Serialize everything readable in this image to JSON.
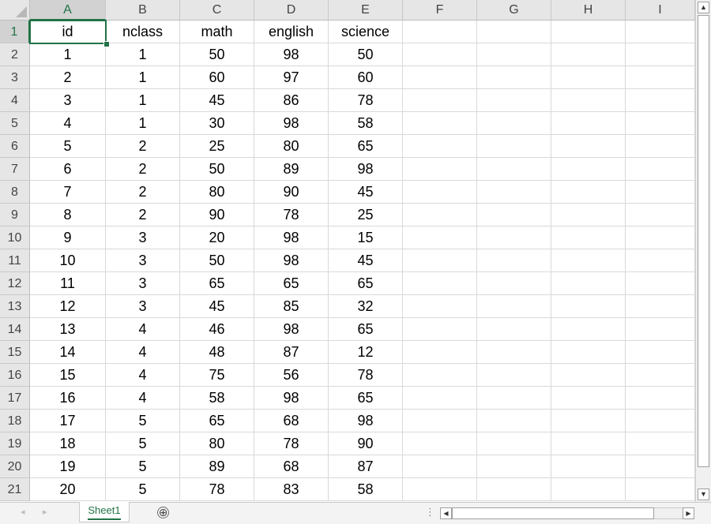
{
  "columns": [
    "A",
    "B",
    "C",
    "D",
    "E",
    "F",
    "G",
    "H",
    "I"
  ],
  "active_cell": "A1",
  "sheet": {
    "header": [
      "id",
      "nclass",
      "math",
      "english",
      "science"
    ],
    "rows": [
      [
        "1",
        "1",
        "50",
        "98",
        "50"
      ],
      [
        "2",
        "1",
        "60",
        "97",
        "60"
      ],
      [
        "3",
        "1",
        "45",
        "86",
        "78"
      ],
      [
        "4",
        "1",
        "30",
        "98",
        "58"
      ],
      [
        "5",
        "2",
        "25",
        "80",
        "65"
      ],
      [
        "6",
        "2",
        "50",
        "89",
        "98"
      ],
      [
        "7",
        "2",
        "80",
        "90",
        "45"
      ],
      [
        "8",
        "2",
        "90",
        "78",
        "25"
      ],
      [
        "9",
        "3",
        "20",
        "98",
        "15"
      ],
      [
        "10",
        "3",
        "50",
        "98",
        "45"
      ],
      [
        "11",
        "3",
        "65",
        "65",
        "65"
      ],
      [
        "12",
        "3",
        "45",
        "85",
        "32"
      ],
      [
        "13",
        "4",
        "46",
        "98",
        "65"
      ],
      [
        "14",
        "4",
        "48",
        "87",
        "12"
      ],
      [
        "15",
        "4",
        "75",
        "56",
        "78"
      ],
      [
        "16",
        "4",
        "58",
        "98",
        "65"
      ],
      [
        "17",
        "5",
        "65",
        "68",
        "98"
      ],
      [
        "18",
        "5",
        "80",
        "78",
        "90"
      ],
      [
        "19",
        "5",
        "89",
        "68",
        "87"
      ],
      [
        "20",
        "5",
        "78",
        "83",
        "58"
      ]
    ]
  },
  "tabs": [
    {
      "label": "Sheet1",
      "active": true
    }
  ],
  "colors": {
    "accent": "#217346",
    "header_bg": "#e6e6e6",
    "gridline": "#d9d9d9"
  },
  "icons": {
    "nav_prev": "◂",
    "nav_next": "▸",
    "add_sheet": "⊕",
    "up": "▲",
    "down": "▼",
    "left": "◀",
    "right": "▶",
    "split": "⋮"
  }
}
